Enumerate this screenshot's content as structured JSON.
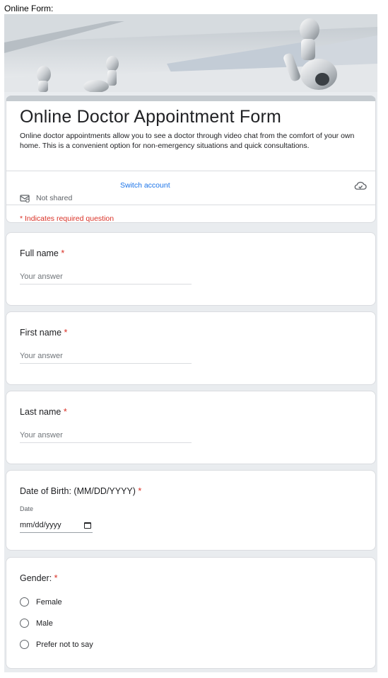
{
  "page_label": "Online Form:",
  "header": {
    "title": "Online Doctor Appointment Form",
    "description": "Online doctor appointments allow you to see a doctor through video chat from the comfort of your own home. This is a convenient option for non-emergency situations and quick consultations.",
    "switch_account": "Switch account",
    "not_shared": "Not shared",
    "required_note": "* Indicates required question",
    "icons": {
      "cloud": "cloud-check-icon",
      "share": "not-shared-icon"
    }
  },
  "questions": {
    "full_name": {
      "label": "Full name",
      "required_mark": "*",
      "placeholder": "Your answer"
    },
    "first_name": {
      "label": "First name",
      "required_mark": "*",
      "placeholder": "Your answer"
    },
    "last_name": {
      "label": "Last name",
      "required_mark": "*",
      "placeholder": "Your answer"
    },
    "dob": {
      "label": "Date of Birth: (MM/DD/YYYY)",
      "required_mark": "*",
      "sublabel": "Date",
      "value": "mm/dd/yyyy"
    },
    "gender": {
      "label": "Gender:",
      "required_mark": "*",
      "options": [
        "Female",
        "Male",
        "Prefer not to say"
      ]
    }
  },
  "colors": {
    "required": "#d93025",
    "link": "#1a73e8",
    "background": "#e9ecef"
  }
}
